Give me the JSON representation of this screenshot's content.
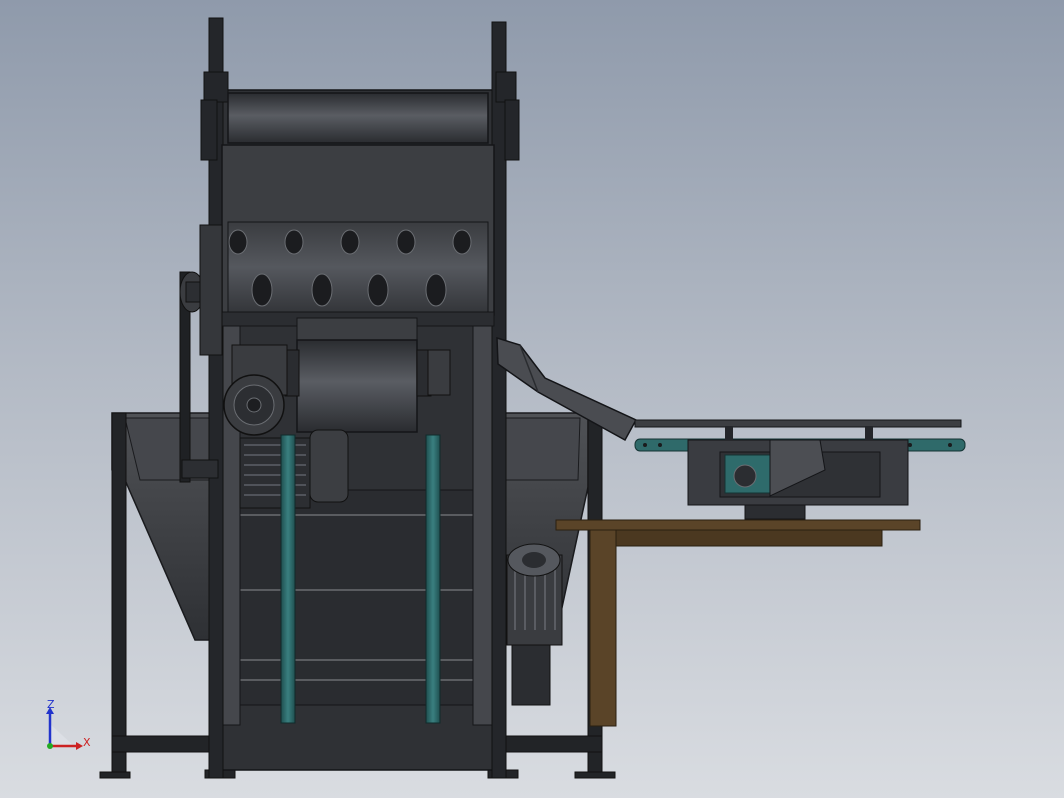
{
  "viewport": {
    "background_top": "#8f9aab",
    "background_bottom": "#d9dce1"
  },
  "triad": {
    "z_label": "Z",
    "x_label": "X",
    "z_color": "#2233cc",
    "x_color": "#cc2222",
    "y_color": "#22aa22"
  },
  "model": {
    "primary_color": "#3f4146",
    "frame_color": "#202226",
    "accent_color": "#2e6b6b",
    "table_color": "#5a4428"
  }
}
